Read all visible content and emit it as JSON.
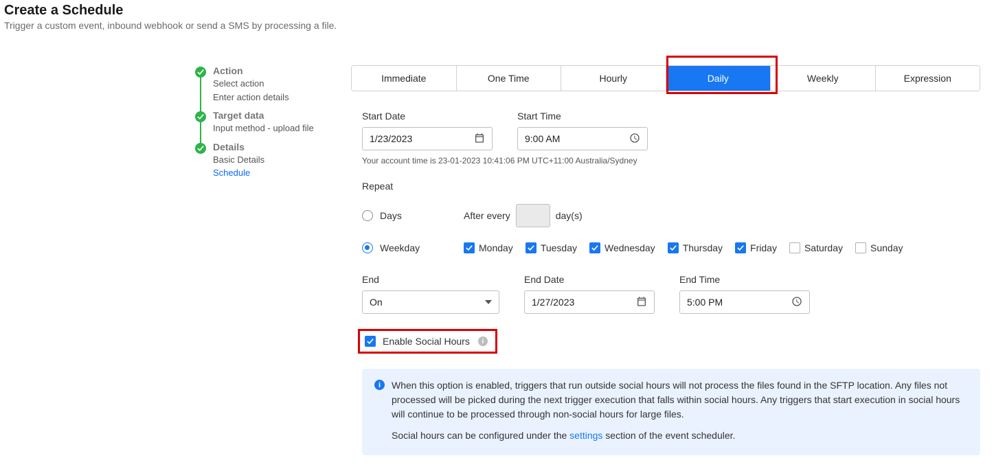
{
  "header": {
    "title": "Create a Schedule",
    "subtitle": "Trigger a custom event, inbound webhook or send a SMS by processing a file."
  },
  "stepper": {
    "steps": [
      {
        "title": "Action",
        "lines": [
          "Select action",
          "Enter action details"
        ],
        "activeIdx": -1
      },
      {
        "title": "Target data",
        "lines": [
          "Input method - upload file"
        ],
        "activeIdx": -1
      },
      {
        "title": "Details",
        "lines": [
          "Basic Details",
          "Schedule"
        ],
        "activeIdx": 1
      }
    ]
  },
  "tabs": [
    "Immediate",
    "One Time",
    "Hourly",
    "Daily",
    "Weekly",
    "Expression"
  ],
  "activeTab": "Daily",
  "form": {
    "startDateLabel": "Start Date",
    "startDate": "1/23/2023",
    "startTimeLabel": "Start Time",
    "startTime": "9:00 AM",
    "accountTime": "Your account time is 23-01-2023 10:41:06 PM UTC+11:00 Australia/Sydney",
    "repeatLabel": "Repeat",
    "daysRadioLabel": "Days",
    "afterEvery": "After every",
    "daysSuffix": "day(s)",
    "daysValue": "",
    "weekdayRadioLabel": "Weekday",
    "weekdays": [
      {
        "label": "Monday",
        "checked": true
      },
      {
        "label": "Tuesday",
        "checked": true
      },
      {
        "label": "Wednesday",
        "checked": true
      },
      {
        "label": "Thursday",
        "checked": true
      },
      {
        "label": "Friday",
        "checked": true
      },
      {
        "label": "Saturday",
        "checked": false
      },
      {
        "label": "Sunday",
        "checked": false
      }
    ],
    "endLabel": "End",
    "endSelect": "On",
    "endDateLabel": "End Date",
    "endDate": "1/27/2023",
    "endTimeLabel": "End Time",
    "endTime": "5:00 PM",
    "socialLabel": "Enable Social Hours",
    "socialChecked": true,
    "infoPara1": "When this option is enabled, triggers that run outside social hours will not process the files found in the SFTP location. Any files not processed will be picked during the next trigger execution that falls within social hours. Any triggers that start execution in social hours will continue to be processed through non-social hours for large files.",
    "infoPara2a": "Social hours can be configured under the ",
    "infoSettingsLink": "settings",
    "infoPara2b": " section of the event scheduler."
  }
}
